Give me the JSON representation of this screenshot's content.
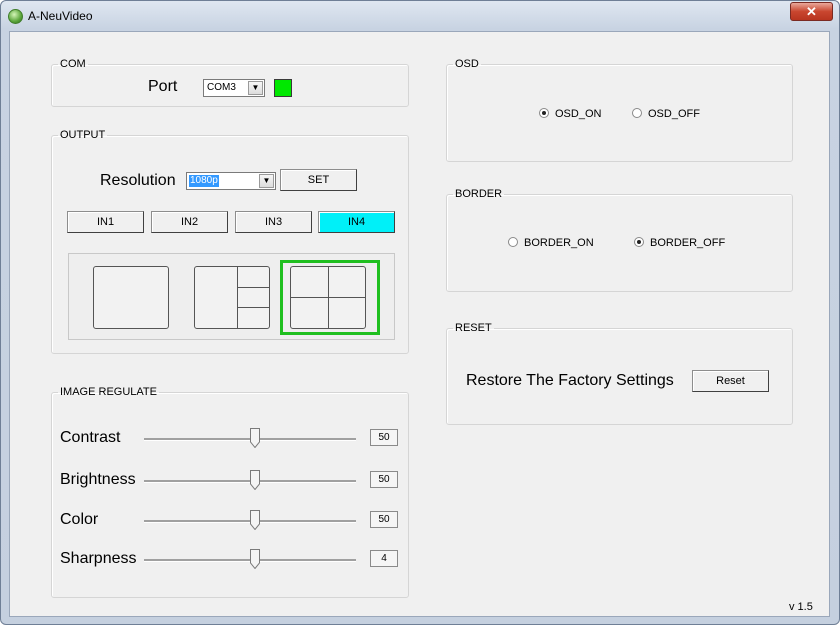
{
  "window": {
    "title": "A-NeuVideo",
    "close_glyph": "✕"
  },
  "com": {
    "legend": "COM",
    "port_label": "Port",
    "port_value": "COM3",
    "status_color": "#00e800"
  },
  "output": {
    "legend": "OUTPUT",
    "resolution_label": "Resolution",
    "resolution_value": "1080p",
    "set_label": "SET",
    "inputs": [
      "IN1",
      "IN2",
      "IN3",
      "IN4"
    ],
    "active_input": "IN4",
    "layouts": [
      "single",
      "one-plus-three",
      "quad"
    ],
    "selected_layout": "quad"
  },
  "image_regulate": {
    "legend": "IMAGE REGULATE",
    "sliders": [
      {
        "label": "Contrast",
        "value": "50",
        "level": 0.5
      },
      {
        "label": "Brightness",
        "value": "50",
        "level": 0.5
      },
      {
        "label": "Color",
        "value": "50",
        "level": 0.5
      },
      {
        "label": "Sharpness",
        "value": "4",
        "level": 0.5
      }
    ]
  },
  "osd": {
    "legend": "OSD",
    "on_label": "OSD_ON",
    "off_label": "OSD_OFF",
    "selected": "on"
  },
  "border": {
    "legend": "BORDER",
    "on_label": "BORDER_ON",
    "off_label": "BORDER_OFF",
    "selected": "off"
  },
  "reset": {
    "legend": "RESET",
    "text": "Restore The Factory Settings",
    "button_label": "Reset"
  },
  "version": "v 1.5",
  "colors": {
    "active_input": "#00f0f8",
    "selected_layout_border": "#1fbf1f",
    "status_led": "#00e800"
  }
}
